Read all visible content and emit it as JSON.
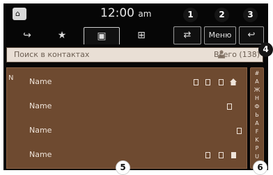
{
  "header": {
    "home_icon": "home-icon",
    "time": "12:00",
    "ampm": "am"
  },
  "toolbar": {
    "tabs": [
      {
        "icon": "call-history-icon",
        "glyph": "↪"
      },
      {
        "icon": "favorites-icon",
        "glyph": "★"
      },
      {
        "icon": "contacts-icon",
        "glyph": "▣"
      },
      {
        "icon": "keypad-icon",
        "glyph": "⊞"
      }
    ],
    "device_switch_icon": "phone-switch-icon",
    "device_switch_glyph": "⇄",
    "menu_label": "Меню",
    "back_icon": "back-icon",
    "back_glyph": "↩"
  },
  "search": {
    "placeholder": "Поиск в контактах",
    "total_label": "Всего (138)"
  },
  "contacts": {
    "section_letter": "N",
    "rows": [
      {
        "name": "Name",
        "icons": [
          "mobile-icon",
          "home-phone-icon",
          "work-phone-icon",
          "home-icon"
        ]
      },
      {
        "name": "Name",
        "icons": [
          "other-phone-icon"
        ]
      },
      {
        "name": "Name",
        "icons": [
          "mobile-icon"
        ]
      },
      {
        "name": "Name",
        "icons": [
          "mobile-icon",
          "home-phone-icon",
          "office-icon"
        ]
      }
    ]
  },
  "index_bar": {
    "letters": [
      "#",
      "А",
      "Ж",
      "Н",
      "Ф",
      "Ь",
      "A",
      "F",
      "K",
      "P",
      "U"
    ]
  },
  "callouts": [
    "1",
    "2",
    "3",
    "4",
    "5",
    "6"
  ]
}
